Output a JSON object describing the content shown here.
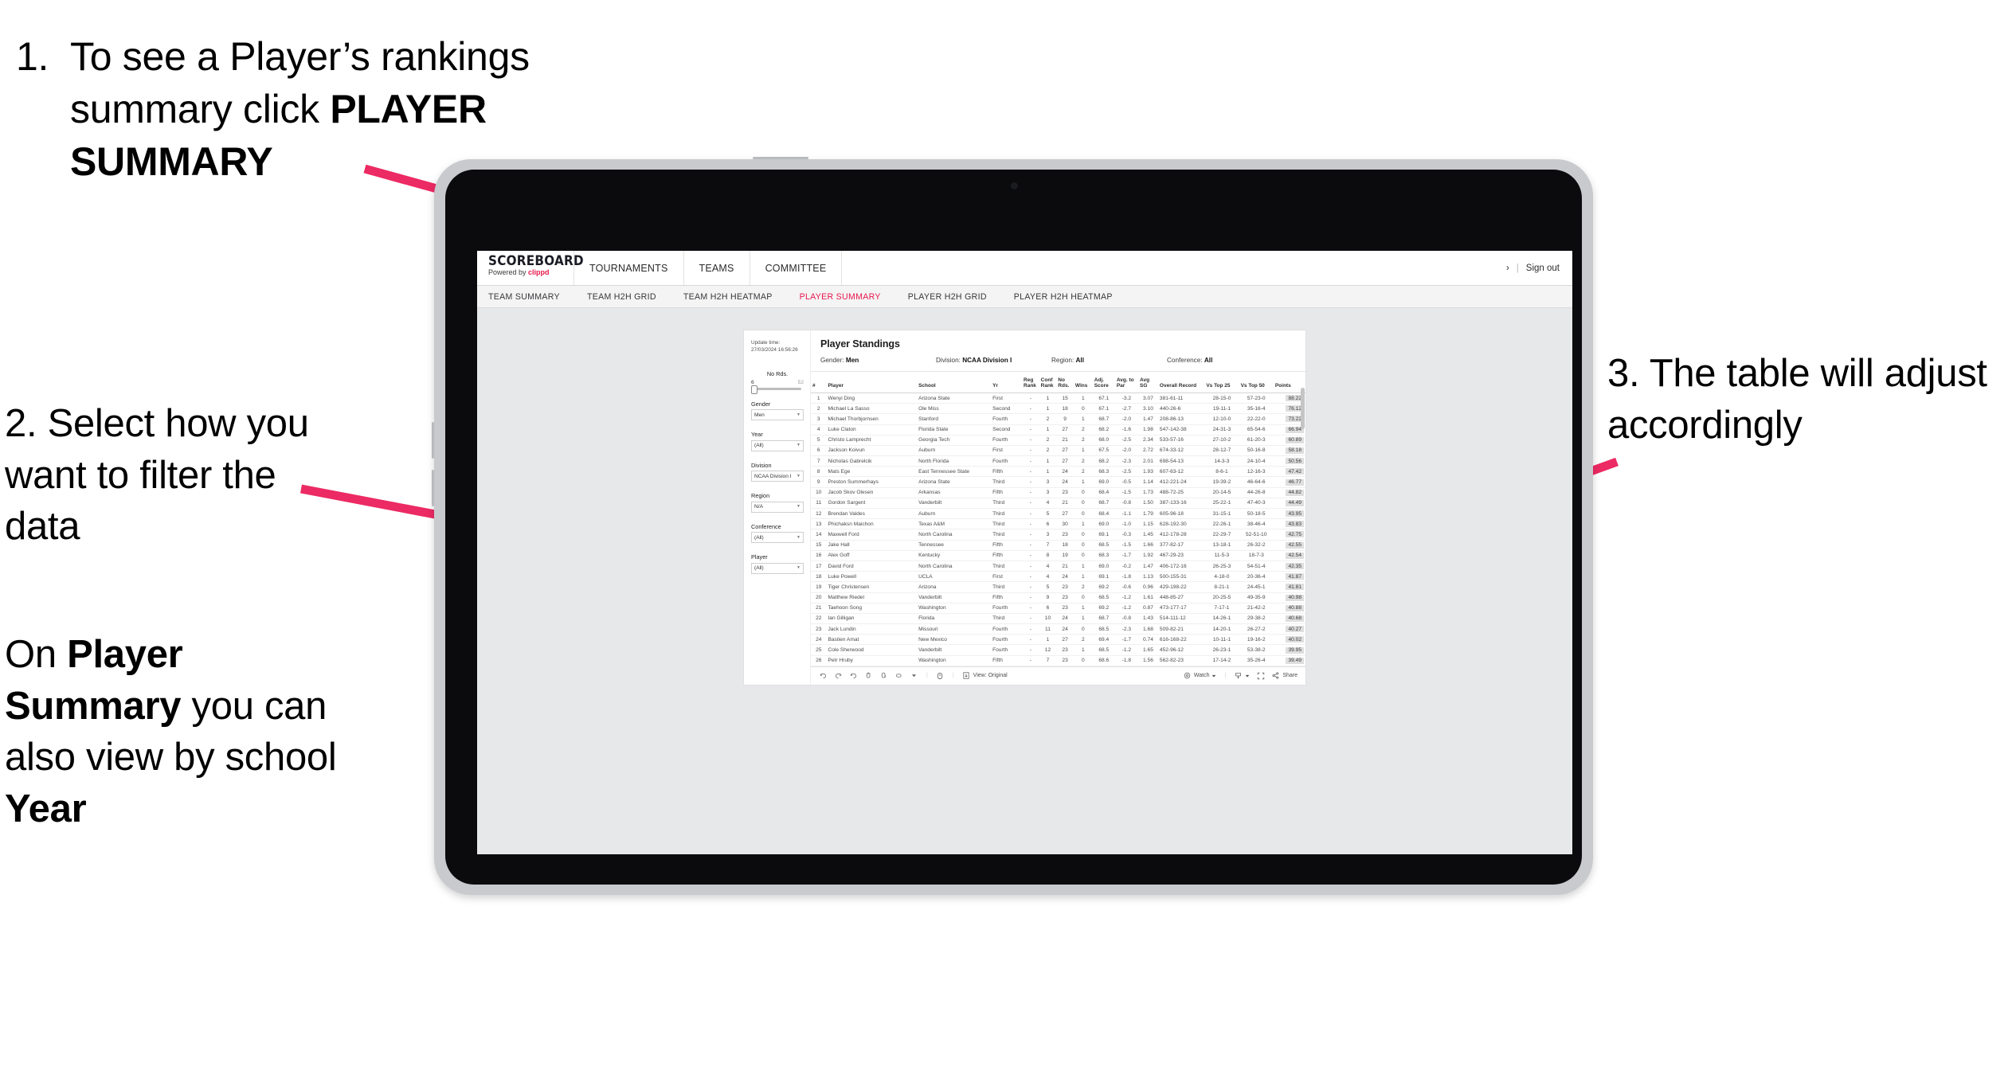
{
  "annotations": {
    "step1": {
      "number": "1.",
      "text_plain_a": "To see a Player’s rankings summary click ",
      "text_bold": "PLAYER SUMMARY"
    },
    "step2": {
      "line": "2. Select how you want to filter the data"
    },
    "step2b": {
      "pre": "On ",
      "bold1": "Player Summary",
      "mid": " you can also view by school ",
      "bold2": "Year"
    },
    "step3": {
      "line": "3. The table will adjust accordingly"
    },
    "arrow_color": "#ec2a63"
  },
  "app": {
    "brand": {
      "title": "SCOREBOARD",
      "powered_prefix": "Powered by ",
      "powered_name": "clippd"
    },
    "topnav": [
      {
        "label": "TOURNAMENTS"
      },
      {
        "label": "TEAMS"
      },
      {
        "label": "COMMITTEE"
      }
    ],
    "topnav_right": {
      "chevron": "›",
      "divider": "|",
      "sign_out": "Sign out"
    },
    "subnav": [
      {
        "label": "TEAM SUMMARY",
        "active": false
      },
      {
        "label": "TEAM H2H GRID",
        "active": false
      },
      {
        "label": "TEAM H2H HEATMAP",
        "active": false
      },
      {
        "label": "PLAYER SUMMARY",
        "active": true
      },
      {
        "label": "PLAYER H2H GRID",
        "active": false
      },
      {
        "label": "PLAYER H2H HEATMAP",
        "active": false
      }
    ],
    "accent_color": "#e8174c"
  },
  "dashboard": {
    "update_time_label": "Update time:",
    "update_time_value": "27/03/2024 16:56:26",
    "title": "Player Standings",
    "filter_summary": [
      {
        "label": "Gender:",
        "value": "Men"
      },
      {
        "label": "Division:",
        "value": "NCAA Division I"
      },
      {
        "label": "Region:",
        "value": "All"
      },
      {
        "label": "Conference:",
        "value": "All"
      }
    ],
    "filters": {
      "slider": {
        "title": "No Rds.",
        "min": "6",
        "max": "52"
      },
      "selects": [
        {
          "label": "Gender",
          "value": "Men"
        },
        {
          "label": "Year",
          "value": "(All)"
        },
        {
          "label": "Division",
          "value": "NCAA Division I"
        },
        {
          "label": "Region",
          "value": "N/A"
        },
        {
          "label": "Conference",
          "value": "(All)"
        },
        {
          "label": "Player",
          "value": "(All)"
        }
      ]
    },
    "toolbar": {
      "view_label": "View: Original",
      "watch_label": "Watch",
      "share_label": "Share"
    }
  },
  "chart_data": {
    "type": "table",
    "title": "Player Standings",
    "columns": [
      "#",
      "Player",
      "School",
      "Yr",
      "Reg Rank",
      "Conf Rank",
      "No Rds.",
      "Wins",
      "Adj. Score",
      "Avg. to Par",
      "Avg SG",
      "Overall Record",
      "Vs Top 25",
      "Vs Top 50",
      "Points"
    ],
    "rows": [
      [
        "1",
        "Wenyi Ding",
        "Arizona State",
        "First",
        "-",
        "1",
        "15",
        "1",
        "67.1",
        "-3.2",
        "3.07",
        "381-61-11",
        "28-15-0",
        "57-23-0",
        "88.22"
      ],
      [
        "2",
        "Michael La Sasso",
        "Ole Miss",
        "Second",
        "-",
        "1",
        "18",
        "0",
        "67.1",
        "-2.7",
        "3.10",
        "440-26-6",
        "19-11-1",
        "35-16-4",
        "76.12"
      ],
      [
        "3",
        "Michael Thorbjornsen",
        "Stanford",
        "Fourth",
        "-",
        "2",
        "9",
        "1",
        "68.7",
        "-2.0",
        "1.47",
        "208-86-13",
        "12-10-0",
        "22-22-0",
        "73.22"
      ],
      [
        "4",
        "Luke Claton",
        "Florida State",
        "Second",
        "-",
        "1",
        "27",
        "2",
        "68.2",
        "-1.6",
        "1.98",
        "547-142-38",
        "24-31-3",
        "65-54-6",
        "66.94"
      ],
      [
        "5",
        "Christo Lamprecht",
        "Georgia Tech",
        "Fourth",
        "-",
        "2",
        "21",
        "2",
        "68.0",
        "-2.5",
        "2.34",
        "533-57-16",
        "27-10-2",
        "61-20-3",
        "60.89"
      ],
      [
        "6",
        "Jackson Koivun",
        "Auburn",
        "First",
        "-",
        "2",
        "27",
        "1",
        "67.5",
        "-2.0",
        "2.72",
        "674-33-12",
        "28-12-7",
        "50-16-8",
        "58.18"
      ],
      [
        "7",
        "Nicholas Gabrelcik",
        "North Florida",
        "Fourth",
        "-",
        "1",
        "27",
        "2",
        "68.2",
        "-2.3",
        "2.01",
        "698-54-13",
        "14-3-3",
        "24-10-4",
        "50.56"
      ],
      [
        "8",
        "Mats Ege",
        "East Tennessee State",
        "Fifth",
        "-",
        "1",
        "24",
        "2",
        "68.3",
        "-2.5",
        "1.93",
        "607-63-12",
        "8-6-1",
        "12-16-3",
        "47.42"
      ],
      [
        "9",
        "Preston Summerhays",
        "Arizona State",
        "Third",
        "-",
        "3",
        "24",
        "1",
        "69.0",
        "-0.5",
        "1.14",
        "412-221-24",
        "19-39-2",
        "46-64-6",
        "46.77"
      ],
      [
        "10",
        "Jacob Skov Olesen",
        "Arkansas",
        "Fifth",
        "-",
        "3",
        "23",
        "0",
        "68.4",
        "-1.5",
        "1.73",
        "488-72-25",
        "20-14-5",
        "44-26-8",
        "44.82"
      ],
      [
        "11",
        "Gordon Sargent",
        "Vanderbilt",
        "Third",
        "-",
        "4",
        "21",
        "0",
        "68.7",
        "-0.8",
        "1.50",
        "387-133-16",
        "25-22-1",
        "47-40-3",
        "44.49"
      ],
      [
        "12",
        "Brendan Valdes",
        "Auburn",
        "Third",
        "-",
        "5",
        "27",
        "0",
        "68.4",
        "-1.1",
        "1.79",
        "605-96-18",
        "31-15-1",
        "50-18-5",
        "43.95"
      ],
      [
        "13",
        "Phichaksn Maichon",
        "Texas A&M",
        "Third",
        "-",
        "6",
        "30",
        "1",
        "69.0",
        "-1.0",
        "1.15",
        "628-192-30",
        "22-26-1",
        "38-46-4",
        "43.83"
      ],
      [
        "14",
        "Maxwell Ford",
        "North Carolina",
        "Third",
        "-",
        "3",
        "23",
        "0",
        "69.1",
        "-0.3",
        "1.45",
        "412-178-28",
        "22-29-7",
        "52-51-10",
        "42.75"
      ],
      [
        "15",
        "Jake Hall",
        "Tennessee",
        "Fifth",
        "-",
        "7",
        "18",
        "0",
        "68.5",
        "-1.5",
        "1.66",
        "377-82-17",
        "13-18-1",
        "26-32-2",
        "42.55"
      ],
      [
        "16",
        "Alex Goff",
        "Kentucky",
        "Fifth",
        "-",
        "8",
        "19",
        "0",
        "68.3",
        "-1.7",
        "1.92",
        "467-29-23",
        "11-5-3",
        "18-7-3",
        "42.54"
      ],
      [
        "17",
        "David Ford",
        "North Carolina",
        "Third",
        "-",
        "4",
        "21",
        "1",
        "69.0",
        "-0.2",
        "1.47",
        "406-172-16",
        "26-25-3",
        "54-51-4",
        "42.35"
      ],
      [
        "18",
        "Luke Powell",
        "UCLA",
        "First",
        "-",
        "4",
        "24",
        "1",
        "69.1",
        "-1.8",
        "1.13",
        "500-155-31",
        "4-18-0",
        "20-36-4",
        "41.87"
      ],
      [
        "19",
        "Tiger Christensen",
        "Arizona",
        "Third",
        "-",
        "5",
        "23",
        "2",
        "69.2",
        "-0.6",
        "0.96",
        "429-198-22",
        "8-21-1",
        "24-45-1",
        "41.81"
      ],
      [
        "20",
        "Matthew Riedel",
        "Vanderbilt",
        "Fifth",
        "-",
        "9",
        "23",
        "0",
        "68.5",
        "-1.2",
        "1.61",
        "448-85-27",
        "20-25-5",
        "49-35-9",
        "40.98"
      ],
      [
        "21",
        "Taehoon Song",
        "Washington",
        "Fourth",
        "-",
        "6",
        "23",
        "1",
        "69.2",
        "-1.2",
        "0.87",
        "473-177-17",
        "7-17-1",
        "21-42-2",
        "40.88"
      ],
      [
        "22",
        "Ian Gilligan",
        "Florida",
        "Third",
        "-",
        "10",
        "24",
        "1",
        "68.7",
        "-0.8",
        "1.43",
        "514-111-12",
        "14-26-1",
        "29-38-2",
        "40.68"
      ],
      [
        "23",
        "Jack Lundin",
        "Missouri",
        "Fourth",
        "-",
        "11",
        "24",
        "0",
        "68.5",
        "-2.3",
        "1.68",
        "509-82-21",
        "14-20-1",
        "26-27-2",
        "40.27"
      ],
      [
        "24",
        "Bastien Amat",
        "New Mexico",
        "Fourth",
        "-",
        "1",
        "27",
        "2",
        "69.4",
        "-1.7",
        "0.74",
        "616-168-22",
        "10-11-1",
        "19-16-2",
        "40.02"
      ],
      [
        "25",
        "Cole Sherwood",
        "Vanderbilt",
        "Fourth",
        "-",
        "12",
        "23",
        "1",
        "68.5",
        "-1.2",
        "1.65",
        "452-96-12",
        "26-23-1",
        "53-38-2",
        "39.95"
      ],
      [
        "26",
        "Petr Hruby",
        "Washington",
        "Fifth",
        "-",
        "7",
        "23",
        "0",
        "68.6",
        "-1.8",
        "1.56",
        "562-82-23",
        "17-14-2",
        "35-26-4",
        "39.49"
      ]
    ]
  }
}
